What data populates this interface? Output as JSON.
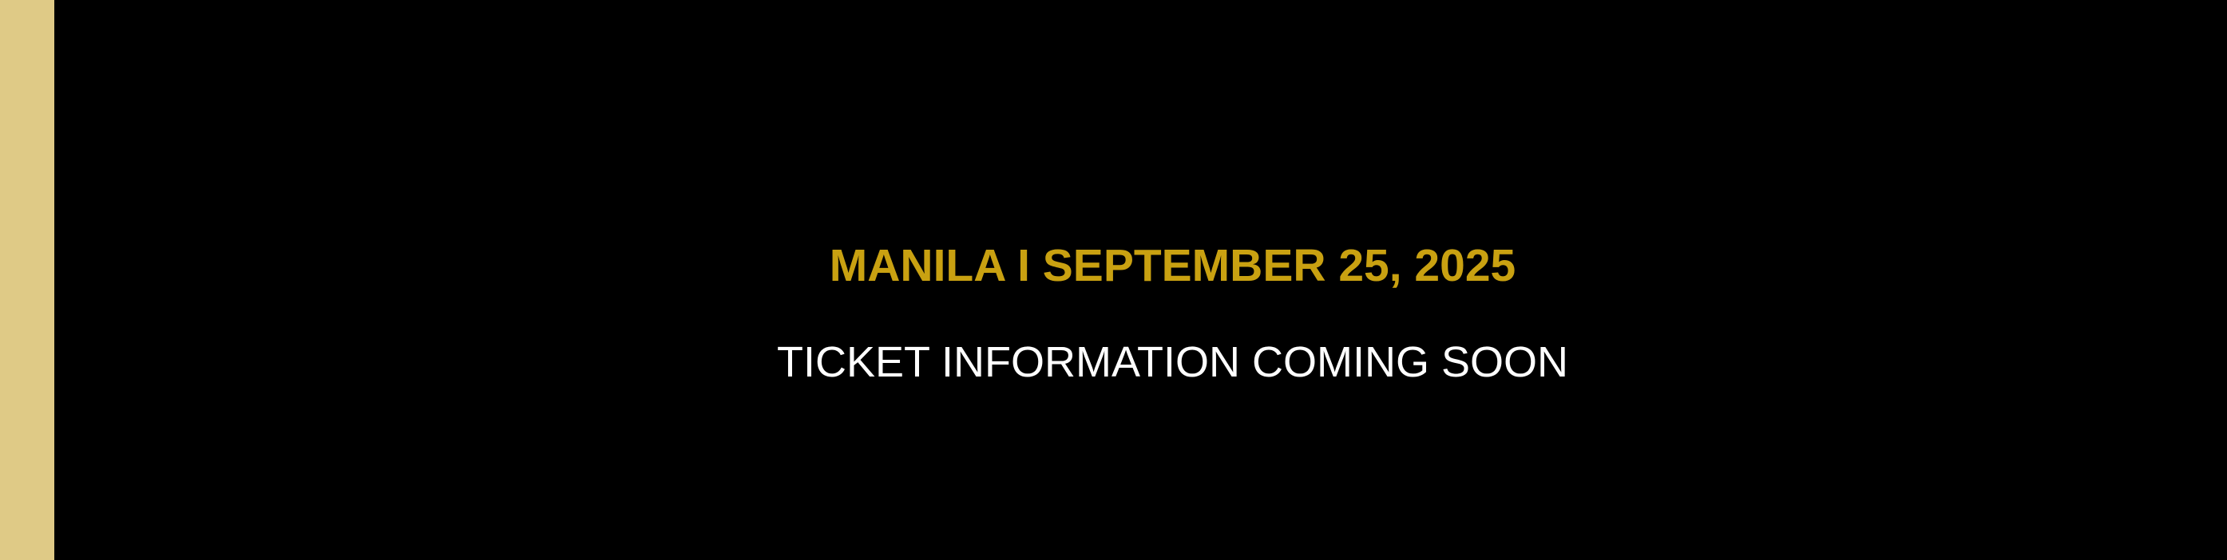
{
  "banner": {
    "event_line": "MANILA I SEPTEMBER 25, 2025",
    "ticket_line": "TICKET INFORMATION COMING SOON"
  },
  "colors": {
    "background": "#000000",
    "side_strip": "#dfca86",
    "accent_gold": "#c9a111",
    "text_white": "#ffffff"
  }
}
